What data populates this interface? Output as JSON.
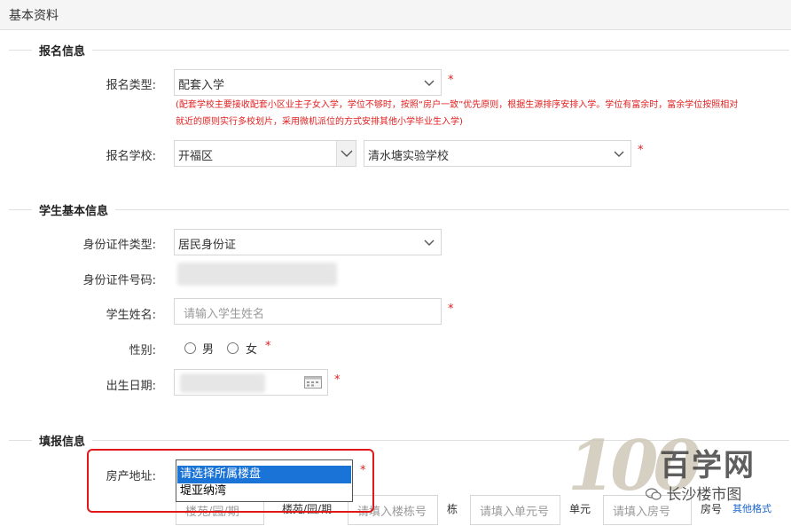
{
  "window": {
    "title": "基本资料"
  },
  "sections": {
    "registration": "报名信息",
    "student": "学生基本信息",
    "fill": "填报信息"
  },
  "registration": {
    "type_label": "报名类型:",
    "type_value": "配套入学",
    "note": "(配套学校主要接收配套小区业主子女入学，学位不够时，按照“房户一致”优先原则，根据生源排序安排入学。学位有富余时，富余学位按照相对就近的原则实行多校划片，采用微机派位的方式安排其他小学毕业生入学)",
    "school_label": "报名学校:",
    "district_value": "开福区",
    "school_value": "清水塘实验学校"
  },
  "student": {
    "id_type_label": "身份证件类型:",
    "id_type_value": "居民身份证",
    "id_number_label": "身份证件号码:",
    "name_label": "学生姓名:",
    "name_placeholder": "请输入学生姓名",
    "gender_label": "性别:",
    "gender_male": "男",
    "gender_female": "女",
    "birth_label": "出生日期:"
  },
  "fill": {
    "property_label": "房产地址:",
    "options": [
      "请选择所属楼盘",
      "堤亚纳湾"
    ],
    "selected_index": 0,
    "building_placeholder_1": "楼苑/园/期",
    "building_unit_1": "楼苑/园/期",
    "building_placeholder_2": "请填入楼栋号",
    "building_unit_2": "栋",
    "unit_placeholder": "请填入单元号",
    "unit_unit": "单元",
    "room_placeholder": "请填入房号",
    "room_unit": "房号",
    "other_link": "其他格式"
  },
  "required_mark": "*",
  "watermark": {
    "digits": "100",
    "text": "百学网",
    "sub": "长沙楼市图"
  },
  "colors": {
    "required": "#e02020",
    "highlight": "#e01818",
    "selected_option": "#1a73d6"
  }
}
